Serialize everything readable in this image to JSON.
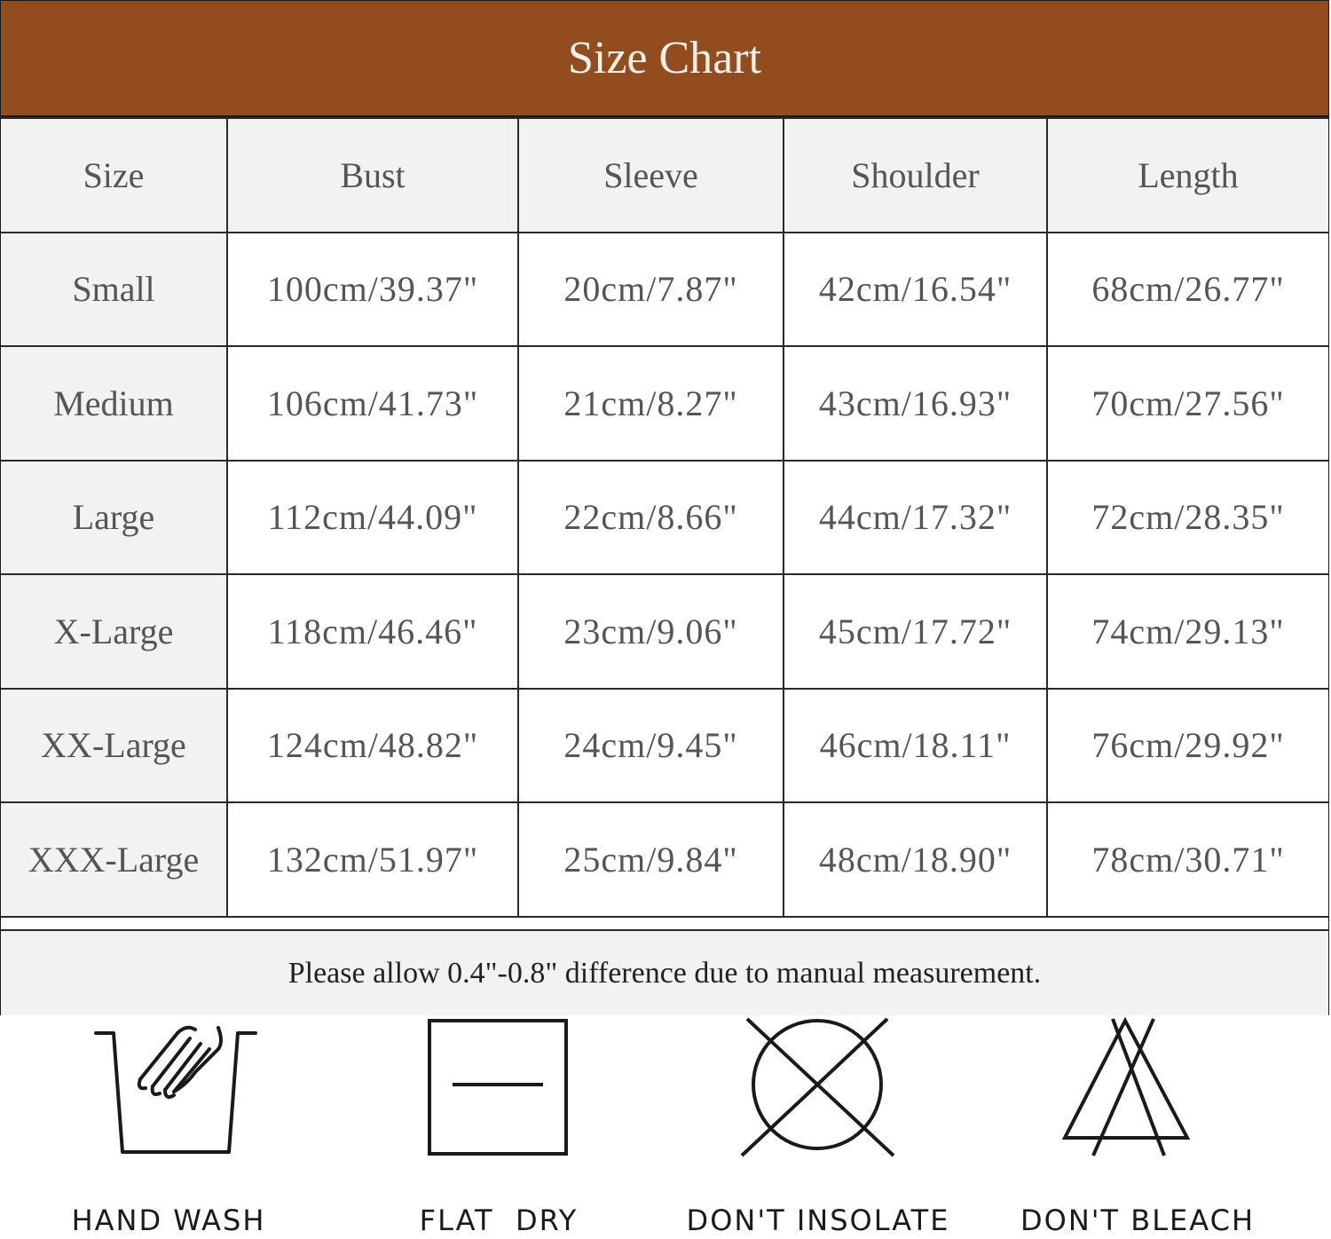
{
  "header": {
    "title": "Size Chart"
  },
  "header_bg": "#934c1e",
  "table": {
    "columns": [
      "Size",
      "Bust",
      "Sleeve",
      "Shoulder",
      "Length"
    ],
    "rows": [
      [
        "Small",
        "100cm/39.37\"",
        "20cm/7.87\"",
        "42cm/16.54\"",
        "68cm/26.77\""
      ],
      [
        "Medium",
        "106cm/41.73\"",
        "21cm/8.27\"",
        "43cm/16.93\"",
        "70cm/27.56\""
      ],
      [
        "Large",
        "112cm/44.09\"",
        "22cm/8.66\"",
        "44cm/17.32\"",
        "72cm/28.35\""
      ],
      [
        "X-Large",
        "118cm/46.46\"",
        "23cm/9.06\"",
        "45cm/17.72\"",
        "74cm/29.13\""
      ],
      [
        "XX-Large",
        "124cm/48.82\"",
        "24cm/9.45\"",
        "46cm/18.11\"",
        "76cm/29.92\""
      ],
      [
        "XXX-Large",
        "132cm/51.97\"",
        "25cm/9.84\"",
        "48cm/18.90\"",
        "78cm/30.71\""
      ]
    ]
  },
  "note": "Please allow 0.4\"-0.8\" difference due to manual measurement.",
  "care": [
    {
      "icon": "hand-wash-icon",
      "label": "HAND WASH"
    },
    {
      "icon": "flat-dry-icon",
      "label": "FLAT  DRY"
    },
    {
      "icon": "dont-insolate-icon",
      "label": "DON'T INSOLATE"
    },
    {
      "icon": "dont-bleach-icon",
      "label": "DON'T BLEACH"
    }
  ]
}
